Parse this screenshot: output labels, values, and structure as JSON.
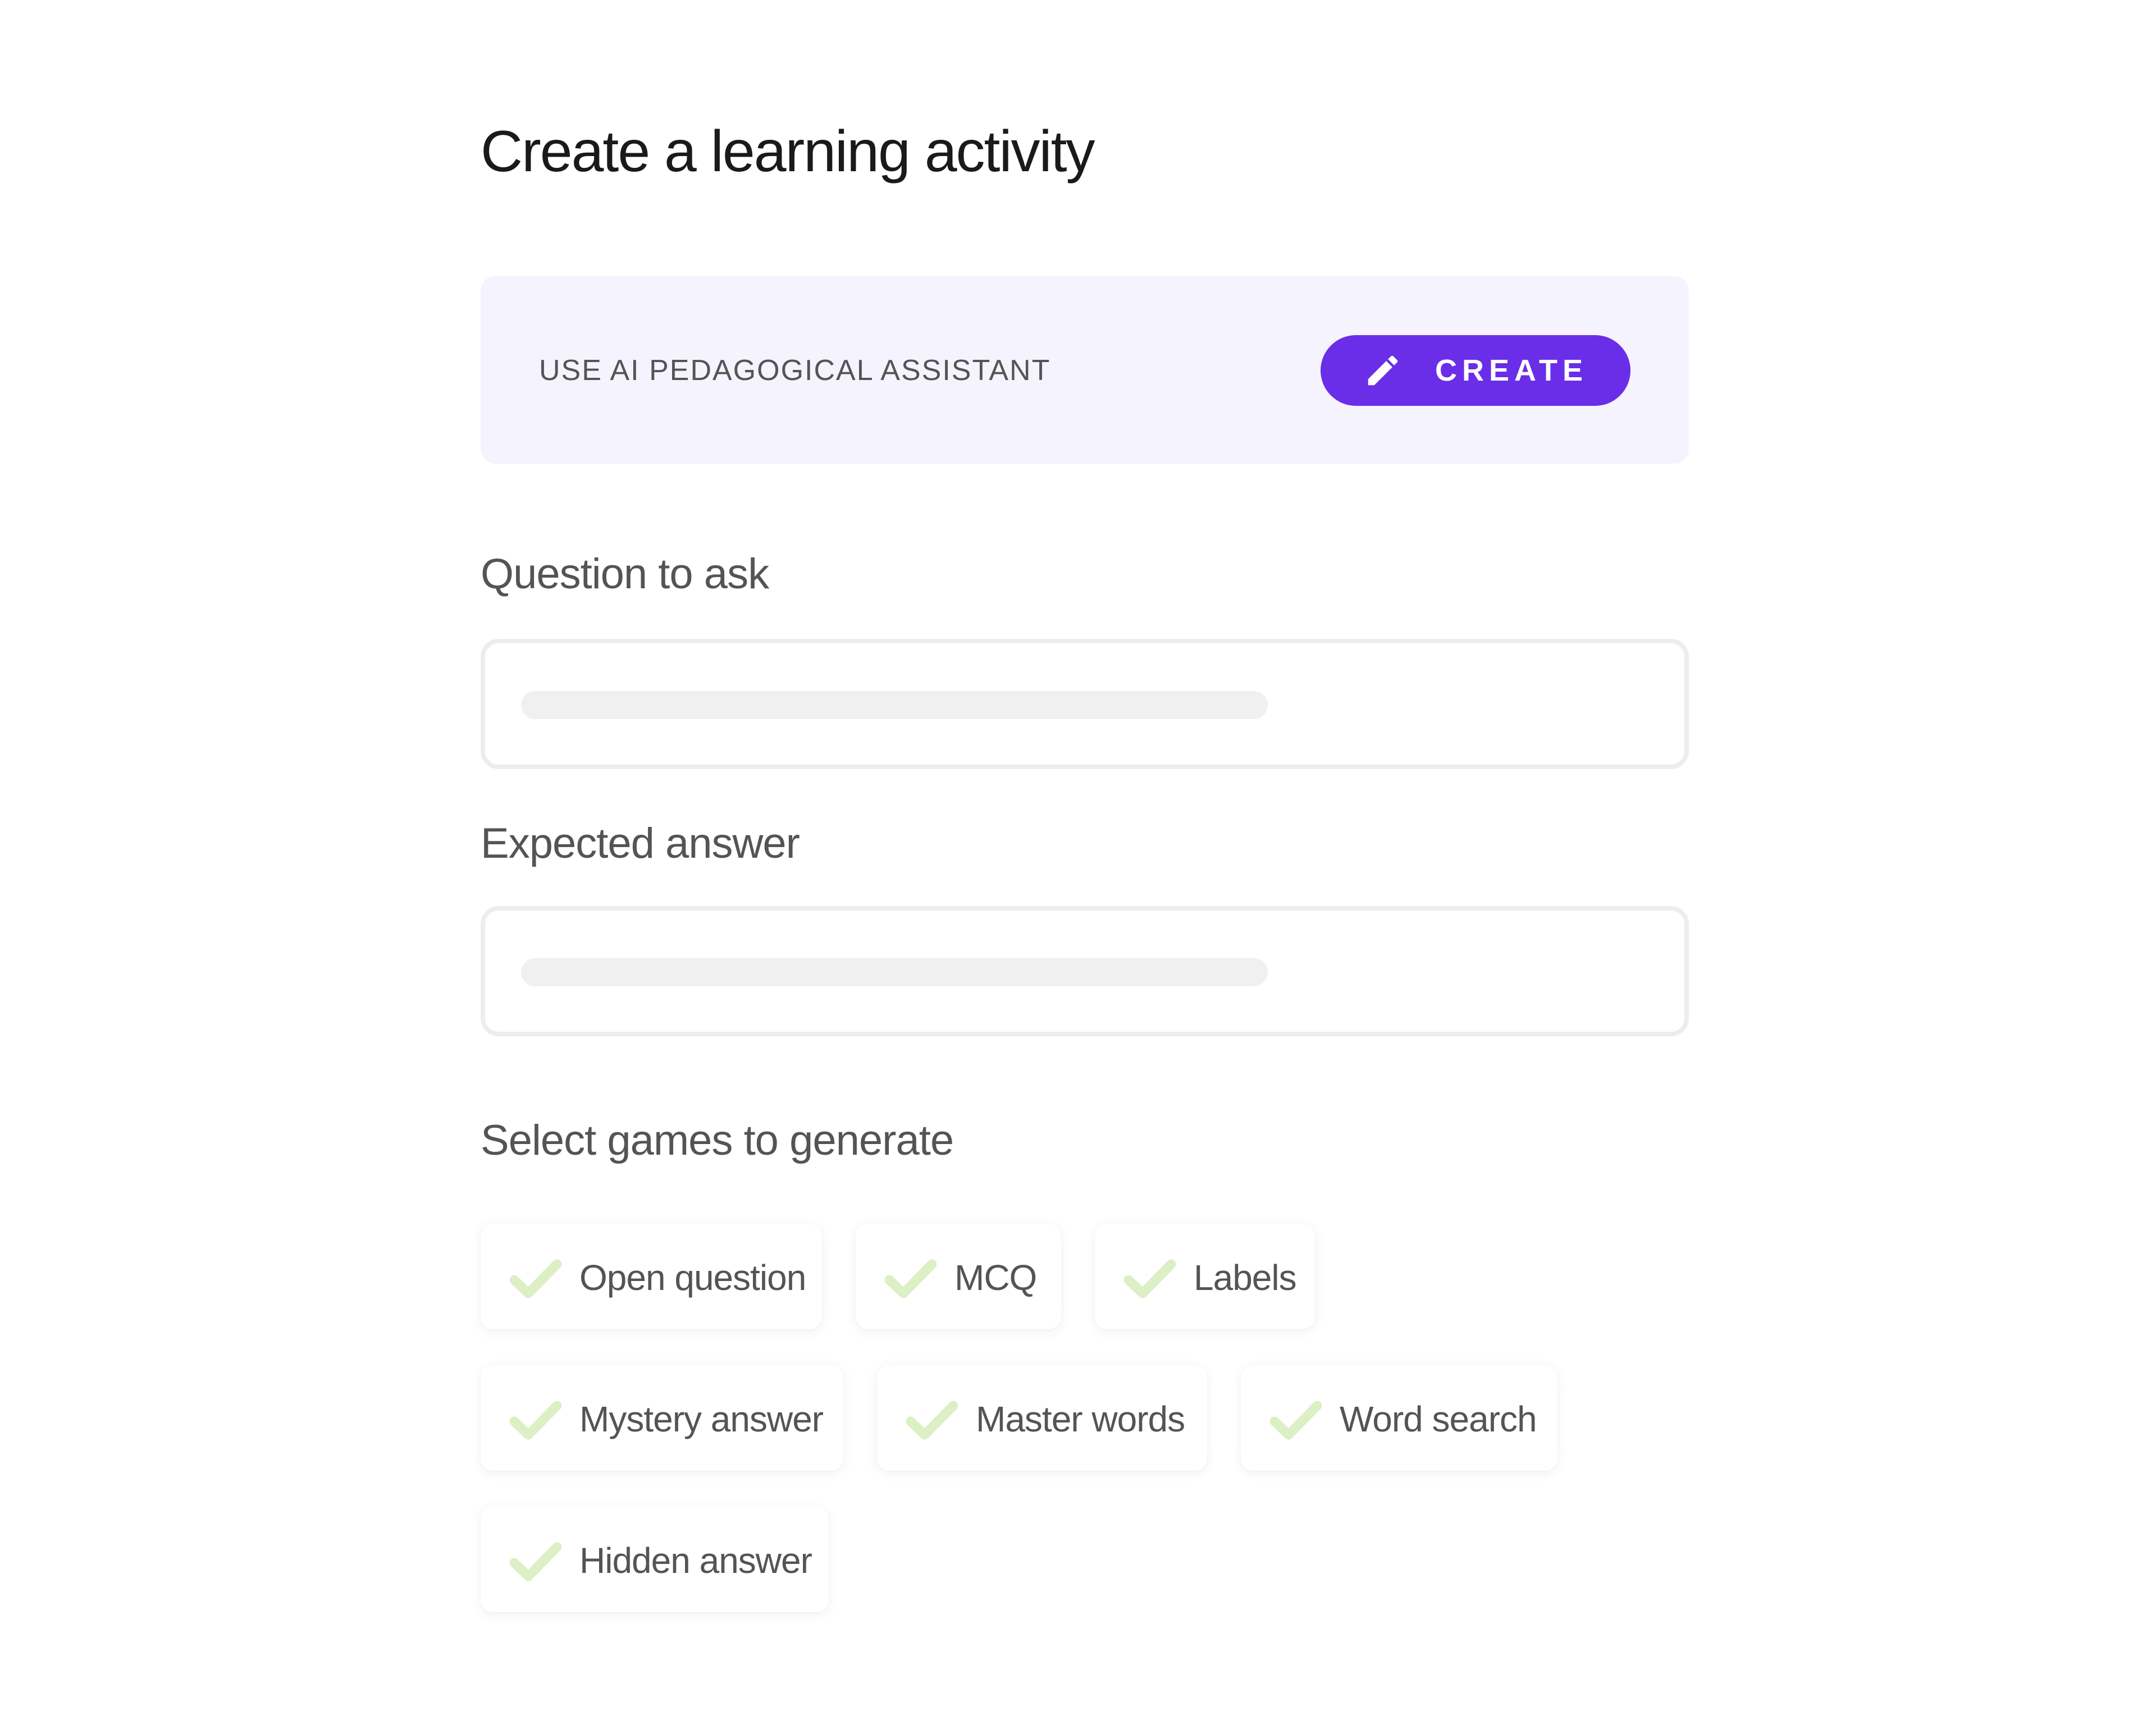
{
  "page": {
    "title": "Create a learning activity"
  },
  "ai_assistant": {
    "label": "USE AI PEDAGOGICAL ASSISTANT",
    "button_label": "CREATE",
    "button_icon": "pencil-icon",
    "accent_color": "#6a2ee8",
    "panel_color": "#f5f3fd"
  },
  "question": {
    "label": "Question to ask",
    "value": ""
  },
  "answer": {
    "label": "Expected answer",
    "value": ""
  },
  "games": {
    "label": "Select games to generate",
    "check_icon": "check-icon",
    "check_color": "#dcefc5",
    "items": [
      {
        "label": "Open question",
        "selected": true
      },
      {
        "label": "MCQ",
        "selected": true
      },
      {
        "label": "Labels",
        "selected": true
      },
      {
        "label": "Mystery answer",
        "selected": true
      },
      {
        "label": "Master words",
        "selected": true
      },
      {
        "label": "Word search",
        "selected": true
      },
      {
        "label": "Hidden answer",
        "selected": true
      }
    ]
  }
}
